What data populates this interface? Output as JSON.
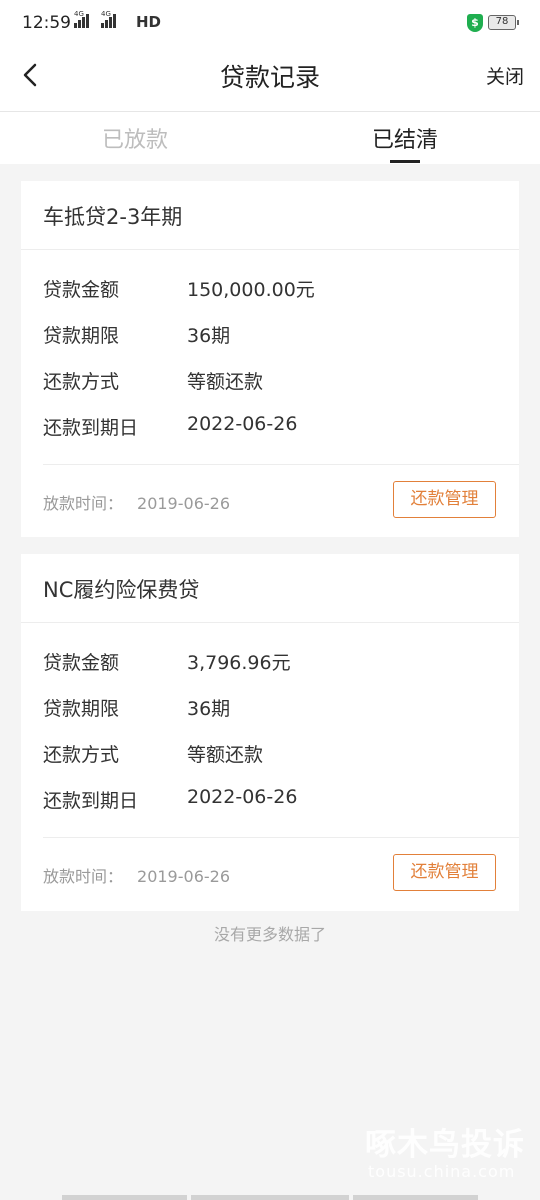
{
  "status_bar": {
    "time": "12:59",
    "network": "HD",
    "battery": "78",
    "shield_icon": "$"
  },
  "nav": {
    "title": "贷款记录",
    "close_label": "关闭",
    "back_icon": "chevron-left-icon"
  },
  "tabs": [
    {
      "label": "已放款",
      "active": false
    },
    {
      "label": "已结清",
      "active": true
    }
  ],
  "loans": [
    {
      "name": "车抵贷2-3年期",
      "fields": [
        {
          "label": "贷款金额",
          "value": "150,000.00元"
        },
        {
          "label": "贷款期限",
          "value": "36期"
        },
        {
          "label": "还款方式",
          "value": "等额还款"
        },
        {
          "label": "还款到期日",
          "value": "2022-06-26"
        }
      ],
      "loan_time_label": "放款时间：",
      "loan_time": "2019-06-26",
      "manage_button": "还款管理"
    },
    {
      "name": "NC履约险保费贷",
      "fields": [
        {
          "label": "贷款金额",
          "value": "3,796.96元"
        },
        {
          "label": "贷款期限",
          "value": "36期"
        },
        {
          "label": "还款方式",
          "value": "等额还款"
        },
        {
          "label": "还款到期日",
          "value": "2022-06-26"
        }
      ],
      "loan_time_label": "放款时间：",
      "loan_time": "2019-06-26",
      "manage_button": "还款管理"
    }
  ],
  "footer": {
    "no_more": "没有更多数据了"
  },
  "watermark": {
    "brand": "啄木鸟投诉",
    "url": "tousu.china.com"
  },
  "colors": {
    "accent": "#e2803a",
    "background": "#f4f4f4",
    "shield": "#1fae4f"
  }
}
